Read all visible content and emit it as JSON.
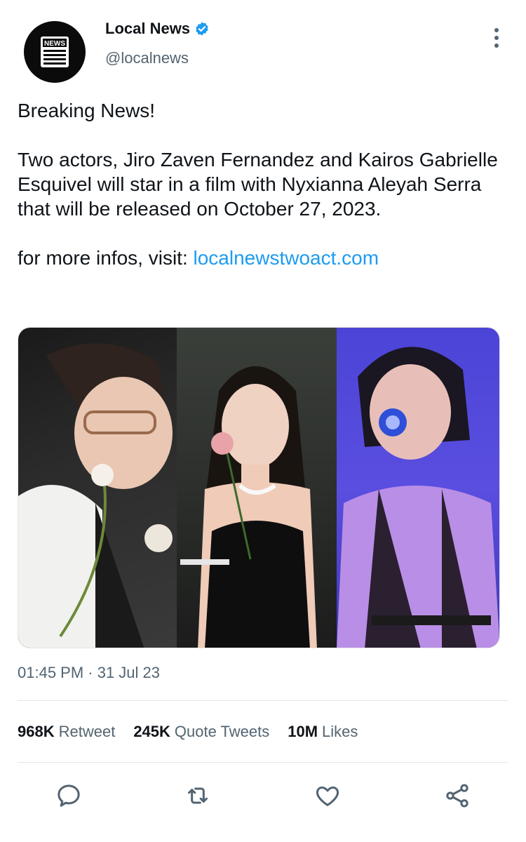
{
  "account": {
    "display_name": "Local News",
    "handle": "@localnews",
    "avatar_label": "NEWS",
    "verified": true,
    "verified_color": "#1d9bf0"
  },
  "tweet": {
    "headline": "Breaking News!",
    "body": "Two actors, Jiro Zaven Fernandez and Kairos Gabrielle Esquivel will star in a film with Nyxianna Aleyah Serra that will be released on October 27, 2023.",
    "more_info_prefix": "for more infos, visit: ",
    "link_text": "localnewstwoact.com",
    "link_color": "#1d9bf0",
    "timestamp": "01:45 PM · 31 Jul 23"
  },
  "stats": {
    "retweets_count": "968K",
    "retweets_label": "Retweet",
    "quotes_count": "245K",
    "quotes_label": "Quote Tweets",
    "likes_count": "10M",
    "likes_label": "Likes"
  },
  "actions": {
    "icons": [
      "reply-icon",
      "retweet-icon",
      "like-icon",
      "share-icon"
    ]
  },
  "colors": {
    "secondary_text": "#536471",
    "primary_text": "#0f1419",
    "panel_right_purple": "#4b44d6"
  }
}
